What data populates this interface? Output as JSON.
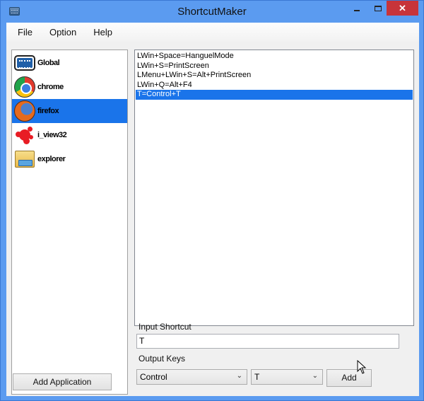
{
  "window": {
    "title": "ShortcutMaker",
    "controls": {
      "minimize": "minimize",
      "maximize": "maximize",
      "close": "✕"
    }
  },
  "menu": [
    "File",
    "Option",
    "Help"
  ],
  "applications": [
    {
      "name": "Global",
      "icon": "keyboard-icon",
      "selected": false
    },
    {
      "name": "chrome",
      "icon": "chrome-icon",
      "selected": false
    },
    {
      "name": "firefox",
      "icon": "firefox-icon",
      "selected": true
    },
    {
      "name": "i_view32",
      "icon": "irfanview-icon",
      "selected": false
    },
    {
      "name": "explorer",
      "icon": "explorer-folder-icon",
      "selected": false
    }
  ],
  "add_application_label": "Add Application",
  "shortcuts": [
    {
      "text": "LWin+Space=HanguelMode",
      "selected": false
    },
    {
      "text": "LWin+S=PrintScreen",
      "selected": false
    },
    {
      "text": "LMenu+LWin+S=Alt+PrintScreen",
      "selected": false
    },
    {
      "text": "LWin+Q=Alt+F4",
      "selected": false
    },
    {
      "text": "T=Control+T",
      "selected": true
    }
  ],
  "input_shortcut": {
    "label": "Input Shortcut",
    "value": "T"
  },
  "output_keys": {
    "label": "Output Keys",
    "modifier": "Control",
    "key": "T",
    "add_label": "Add"
  },
  "colors": {
    "selection": "#1a74ea",
    "title_bar": "#5b9bf0",
    "close_button": "#c7343a"
  }
}
